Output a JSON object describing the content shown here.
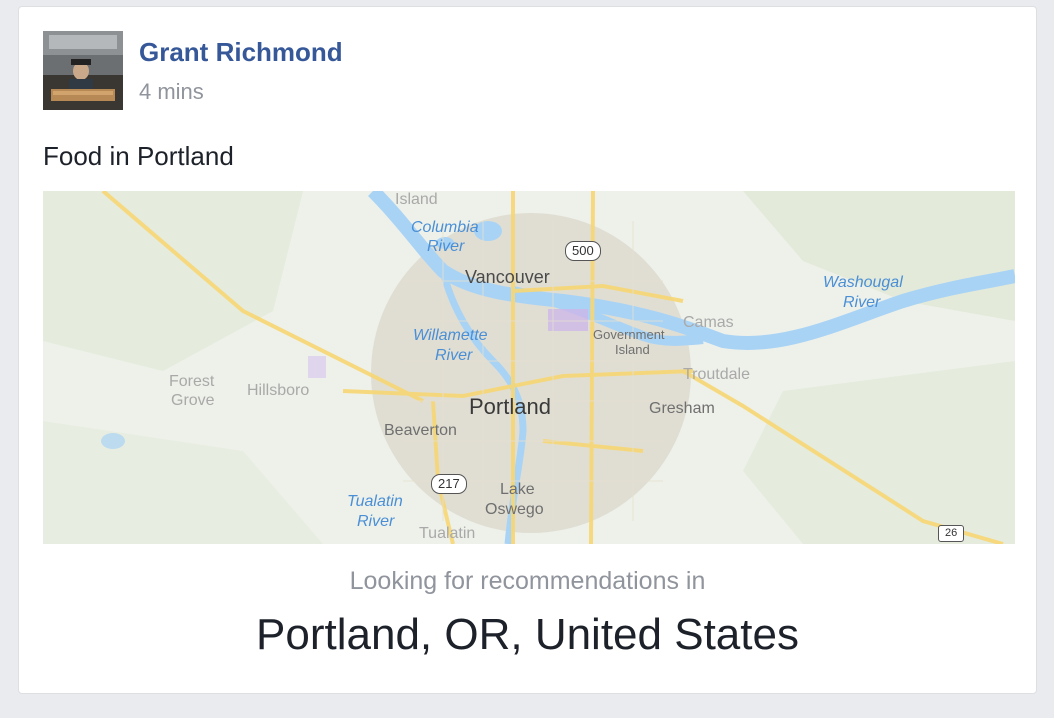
{
  "post": {
    "author": "Grant Richmond",
    "timestamp": "4 mins",
    "text": "Food in Portland"
  },
  "map": {
    "labels": {
      "island_top": "Island",
      "columbia_river_1": "Columbia",
      "columbia_river_2": "River",
      "vancouver": "Vancouver",
      "washougal_river_1": "Washougal",
      "washougal_river_2": "River",
      "camas": "Camas",
      "willamette_river_1": "Willamette",
      "willamette_river_2": "River",
      "government_island_1": "Government",
      "government_island_2": "Island",
      "forest_grove_1": "Forest",
      "forest_grove_2": "Grove",
      "hillsboro": "Hillsboro",
      "troutdale": "Troutdale",
      "portland": "Portland",
      "gresham": "Gresham",
      "beaverton": "Beaverton",
      "lake_oswego_1": "Lake",
      "lake_oswego_2": "Oswego",
      "tualatin_river_1": "Tualatin",
      "tualatin_river_2": "River",
      "tualatin": "Tualatin"
    },
    "shields": {
      "route_500": "500",
      "route_217": "217",
      "route_26": "26"
    }
  },
  "recommendations": {
    "prompt": "Looking for recommendations in",
    "location": "Portland, OR, United States"
  },
  "colors": {
    "author_link": "#365899",
    "secondary_text": "#90949c",
    "water": "#a9d3f5",
    "road": "#f7d774",
    "land": "#eef1ea"
  }
}
